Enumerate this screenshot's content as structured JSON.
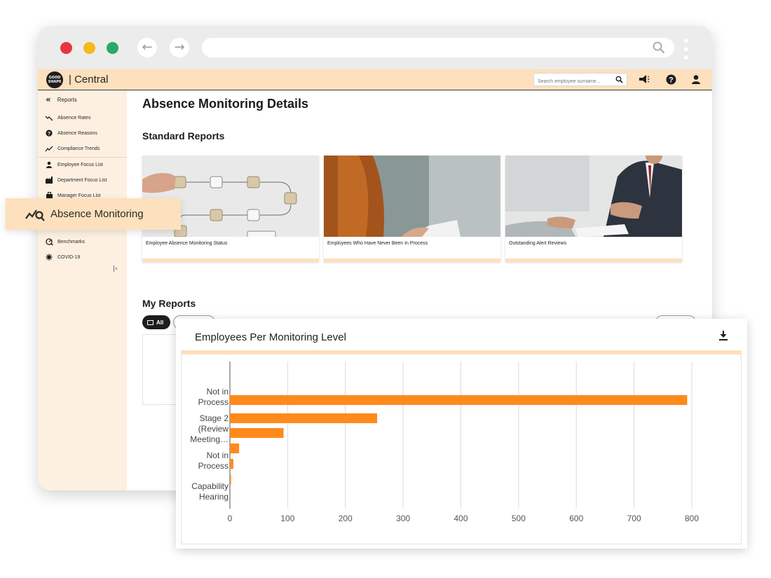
{
  "browser": {
    "back_icon": "arrow-left-icon",
    "forward_icon": "arrow-right-icon",
    "url_value": ""
  },
  "app": {
    "logo_text_1": "GOOD",
    "logo_text_2": "SHAPE",
    "brand": "| Central",
    "search_placeholder": "Search employee surname..."
  },
  "sidebar": {
    "header": "Reports",
    "items": [
      {
        "label": "Absence Rates",
        "icon": "trending-down-icon"
      },
      {
        "label": "Absence Reasons",
        "icon": "question-circle-icon"
      },
      {
        "label": "Compliance Trends",
        "icon": "trending-up-icon"
      },
      {
        "label": "Employee Focus List",
        "icon": "person-icon"
      },
      {
        "label": "Department Focus List",
        "icon": "factory-icon"
      },
      {
        "label": "Manager Focus List",
        "icon": "manager-icon"
      },
      {
        "label": "Benchmarks",
        "icon": "benchmark-icon"
      },
      {
        "label": "COVID-19",
        "icon": "virus-icon"
      }
    ],
    "floating_item": "Absence Monitoring",
    "collapse_glyph": "|‹"
  },
  "main": {
    "title": "Absence Monitoring Details",
    "standard_reports_heading": "Standard Reports",
    "cards": [
      {
        "caption": "Employee Absence Monitoring Status"
      },
      {
        "caption": "Employees Who Have Never Been In Process"
      },
      {
        "caption": "Outstanding Alert Reviews"
      }
    ],
    "my_reports_heading": "My Reports",
    "filter_all": "All"
  },
  "chart_card": {
    "title": "Employees Per Monitoring Level",
    "download_icon": "download-icon"
  },
  "chart_data": {
    "type": "bar",
    "orientation": "horizontal",
    "bar_color": "#ff8a1c",
    "categories_labels": [
      {
        "lines": [
          "Not in",
          "Process"
        ]
      },
      {
        "lines": [
          "Stage 2",
          "(Review",
          "Meeting…"
        ]
      },
      {
        "lines": [
          "Not in",
          "Process"
        ]
      },
      {
        "lines": [
          "Capability",
          "Hearing"
        ]
      }
    ],
    "values": [
      792,
      255,
      93,
      16,
      6,
      2
    ],
    "xlim": [
      0,
      800
    ],
    "xticks": [
      0,
      100,
      200,
      300,
      400,
      500,
      600,
      700,
      800
    ],
    "grid": true
  }
}
